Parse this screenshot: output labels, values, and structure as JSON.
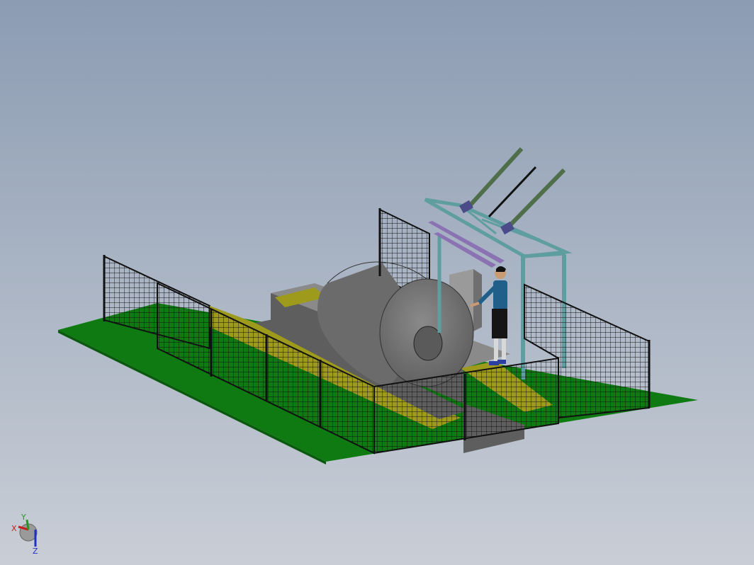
{
  "viewport": {
    "background_top": "#8c9cb3",
    "background_bottom": "#c9ced6"
  },
  "colors": {
    "floor_green": "#0f7a12",
    "floor_edge": "#0a5a0d",
    "walkway_yellow": "#9d9a1c",
    "walkway_yellow_top": "#b8b535",
    "coil_side": "#6b6b6b",
    "coil_face": "#7d7d7d",
    "coil_hole": "#5a5a5a",
    "base_gray": "#8a8a8a",
    "base_dark": "#5e5e5e",
    "fence_mesh": "#111111",
    "frame_teal": "#5e9ea0",
    "frame_teal_dark": "#3f7476",
    "cylinder_green": "#4f6e4a",
    "cylinder_cap": "#4b4b8a",
    "beam_purple": "#8a72b3",
    "cabinet_gray": "#9a9a9a",
    "person_shirt": "#1f5f8a",
    "person_shorts": "#151515",
    "person_skin": "#c99b73",
    "person_legs": "#d8d8d8",
    "person_shoes": "#2a3fa0"
  },
  "triad": {
    "x_label": "X",
    "y_label": "Y",
    "z_label": "Z",
    "x_color": "#c42020",
    "y_color": "#1f9a1f",
    "z_color": "#2030c0"
  }
}
